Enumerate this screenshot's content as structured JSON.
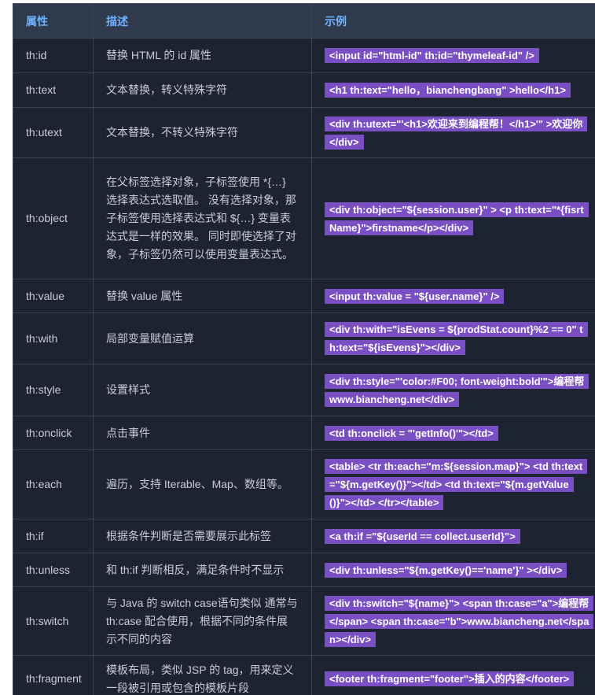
{
  "headers": [
    "属性",
    "描述",
    "示例"
  ],
  "rows": [
    {
      "attr": "th:id",
      "desc": "替换 HTML 的 id 属性",
      "example": "<input id=\"html-id\" th:id=\"thymeleaf-id\" />"
    },
    {
      "attr": "th:text",
      "desc": "文本替换，转义特殊字符",
      "example": "<h1 th:text=\"hello，bianchengbang\" >hello</h1>"
    },
    {
      "attr": "th:utext",
      "desc": "文本替换，不转义特殊字符",
      "example": "<div th:utext=\"'<h1>欢迎来到编程帮！</h1>'\" >欢迎你</div>"
    },
    {
      "attr": "th:object",
      "desc": "在父标签选择对象，子标签使用 *{…} 选择表达式选取值。 没有选择对象，那子标签使用选择表达式和 ${…} 变量表达式是一样的效果。 同时即使选择了对象，子标签仍然可以使用变量表达式。",
      "example": "<div th:object=\"${session.user}\" > <p th:text=\"*{fisrtName}\">firstname</p></div>"
    },
    {
      "attr": "th:value",
      "desc": "替换 value 属性",
      "example": "<input th:value = \"${user.name}\" />"
    },
    {
      "attr": "th:with",
      "desc": "局部变量赋值运算",
      "example": "<div th:with=\"isEvens = ${prodStat.count}%2 == 0\" th:text=\"${isEvens}\"></div>"
    },
    {
      "attr": "th:style",
      "desc": "设置样式",
      "example": "<div th:style=\"'color:#F00; font-weight:bold'\">编程帮 www.biancheng.net</div>"
    },
    {
      "attr": "th:onclick",
      "desc": "点击事件",
      "example": "<td th:onclick = \"'getInfo()'\"></td>"
    },
    {
      "attr": "th:each",
      "desc": "遍历，支持 Iterable、Map、数组等。",
      "example": "<table> <tr th:each=\"m:${session.map}\"> <td th:text=\"${m.getKey()}\"></td> <td th:text=\"${m.getValue()}\"></td> </tr></table>"
    },
    {
      "attr": "th:if",
      "desc": "根据条件判断是否需要展示此标签",
      "example": "<a th:if =\"${userId == collect.userId}\">"
    },
    {
      "attr": "th:unless",
      "desc": "和 th:if 判断相反，满足条件时不显示",
      "example": "<div th:unless=\"${m.getKey()=='name'}\" ></div>"
    },
    {
      "attr": "th:switch",
      "desc": "与 Java 的 switch case语句类似 通常与 th:case 配合使用，根据不同的条件展示不同的内容",
      "example": "<div th:switch=\"${name}\"> <span th:case=\"a\">编程帮</span> <span th:case=\"b\">www.biancheng.net</span></div>"
    },
    {
      "attr": "th:fragment",
      "desc": "模板布局，类似 JSP 的 tag，用来定义一段被引用或包含的模板片段",
      "example": "<footer th:fragment=\"footer\">插入的内容</footer>"
    }
  ]
}
